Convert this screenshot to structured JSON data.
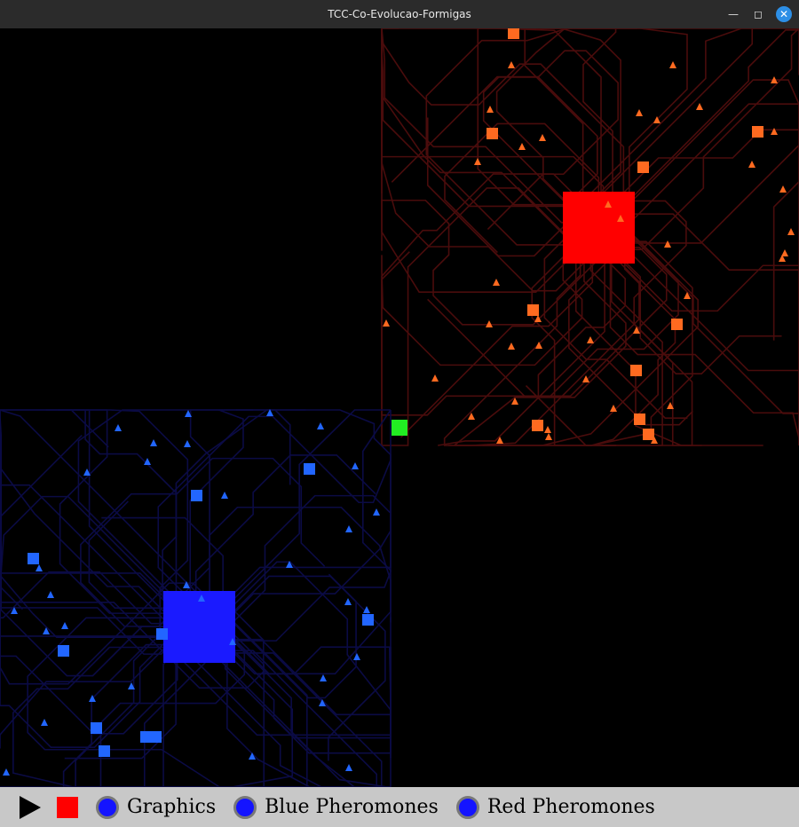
{
  "window": {
    "title": "TCC-Co-Evolucao-Formigas"
  },
  "toolbar": {
    "toggles": [
      {
        "label": "Graphics"
      },
      {
        "label": "Blue Pheromones"
      },
      {
        "label": "Red Pheromones"
      }
    ]
  },
  "colors": {
    "red_nest": "#ff0000",
    "red_ant": "#ff6a20",
    "red_trail": "#4a0c0c",
    "blue_nest": "#1a1aff",
    "blue_ant": "#2266ff",
    "blue_trail": "#0b0b45",
    "food": "#22ee22",
    "toolbar_bg": "#c8c8c8"
  }
}
